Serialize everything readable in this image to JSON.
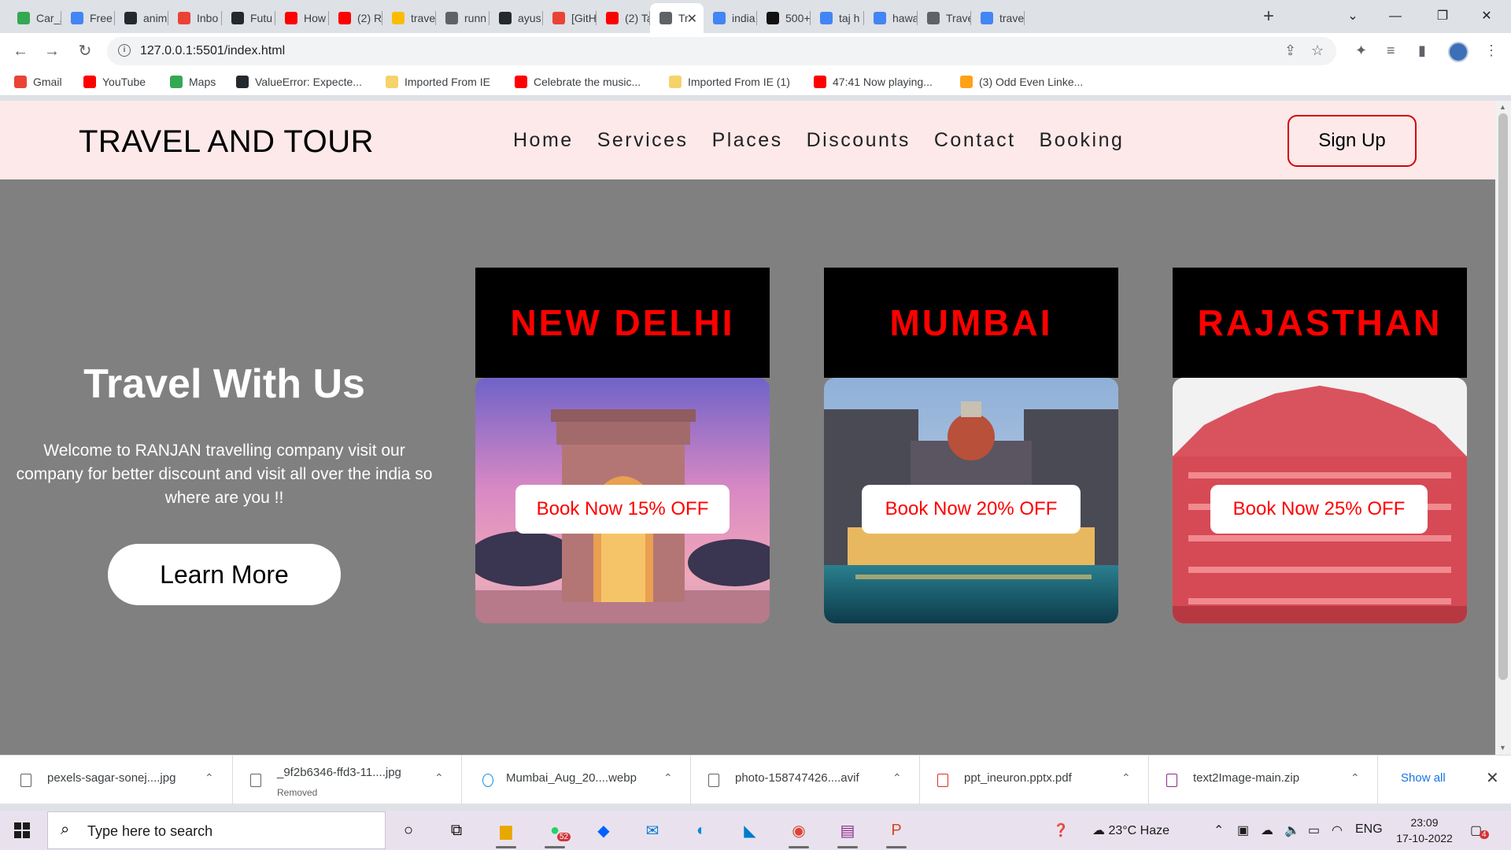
{
  "browser": {
    "tabs": [
      {
        "label": "Car_/",
        "icon": "google-drive-icon",
        "color": "#34a853"
      },
      {
        "label": "Free",
        "icon": "gear-icon",
        "color": "#4285f4"
      },
      {
        "label": "anim",
        "icon": "github-icon",
        "color": "#24292e"
      },
      {
        "label": "Inbo",
        "icon": "gmail-icon",
        "color": "#ea4335"
      },
      {
        "label": "Futu",
        "icon": "github-icon",
        "color": "#24292e"
      },
      {
        "label": "How",
        "icon": "youtube-icon",
        "color": "#ff0000"
      },
      {
        "label": "(2) R",
        "icon": "youtube-icon",
        "color": "#ff0000"
      },
      {
        "label": "trave",
        "icon": "google-drive-icon",
        "color": "#fbbc04"
      },
      {
        "label": "runn",
        "icon": "globe-icon",
        "color": "#5f6368"
      },
      {
        "label": "ayus",
        "icon": "github-icon",
        "color": "#24292e"
      },
      {
        "label": "[GitH",
        "icon": "gmail-icon",
        "color": "#ea4335"
      },
      {
        "label": "(2) Ta",
        "icon": "youtube-icon",
        "color": "#ff0000"
      },
      {
        "label": "Tr",
        "icon": "globe-icon",
        "color": "#5f6368"
      },
      {
        "label": "india",
        "icon": "google-icon",
        "color": "#4285f4"
      },
      {
        "label": "500+",
        "icon": "unsplash-icon",
        "color": "#111111"
      },
      {
        "label": "taj h",
        "icon": "google-icon",
        "color": "#4285f4"
      },
      {
        "label": "hawa",
        "icon": "google-icon",
        "color": "#4285f4"
      },
      {
        "label": "Trave",
        "icon": "globe-icon",
        "color": "#5f6368"
      },
      {
        "label": "trave",
        "icon": "google-icon",
        "color": "#4285f4"
      }
    ],
    "url": "127.0.0.1:5501/index.html",
    "bookmarks": [
      {
        "label": "Gmail",
        "icon": "gmail-icon",
        "color": "#ea4335"
      },
      {
        "label": "YouTube",
        "icon": "youtube-icon",
        "color": "#ff0000"
      },
      {
        "label": "Maps",
        "icon": "maps-pin-icon",
        "color": "#34a853"
      },
      {
        "label": "ValueError: Expecte...",
        "icon": "github-icon",
        "color": "#24292e"
      },
      {
        "label": "Imported From IE",
        "icon": "folder-icon",
        "color": "#f6d26b"
      },
      {
        "label": "Celebrate the music...",
        "icon": "youtube-icon",
        "color": "#ff0000"
      },
      {
        "label": "Imported From IE (1)",
        "icon": "folder-icon",
        "color": "#f6d26b"
      },
      {
        "label": "47:41 Now playing...",
        "icon": "youtube-icon",
        "color": "#ff0000"
      },
      {
        "label": "(3) Odd Even Linke...",
        "icon": "leetcode-icon",
        "color": "#ffa116"
      }
    ]
  },
  "site": {
    "logo": "TRAVEL AND TOUR",
    "nav": [
      "Home",
      "Services",
      "Places",
      "Discounts",
      "Contact",
      "Booking"
    ],
    "signup_label": "Sign Up",
    "hero": {
      "title": "Travel With Us",
      "text": "Welcome to RANJAN travelling company visit our company for better discount and visit all over the india so where are you !!",
      "button": "Learn More"
    },
    "cards": [
      {
        "title": "NEW DELHI",
        "button": "Book Now 15% OFF",
        "image": "india-gate-image"
      },
      {
        "title": "MUMBAI",
        "button": "Book Now 20% OFF",
        "image": "taj-hotel-image"
      },
      {
        "title": "RAJASTHAN",
        "button": "Book Now 25% OFF",
        "image": "hawa-mahal-image"
      }
    ],
    "colors": {
      "header_bg": "#fde9ea",
      "page_bg": "#808080",
      "accent": "#ff0000"
    }
  },
  "downloads": {
    "items": [
      {
        "name": "pexels-sagar-sonej....jpg",
        "sub": ""
      },
      {
        "name": "_9f2b6346-ffd3-11....jpg",
        "sub": "Removed"
      },
      {
        "name": "Mumbai_Aug_20....webp",
        "sub": ""
      },
      {
        "name": "photo-158747426....avif",
        "sub": ""
      },
      {
        "name": "ppt_ineuron.pptx.pdf",
        "sub": ""
      },
      {
        "name": "text2Image-main.zip",
        "sub": ""
      }
    ],
    "show_all": "Show all"
  },
  "taskbar": {
    "search_placeholder": "Type here to search",
    "whatsapp_badge": "52",
    "weather": "23°C  Haze",
    "language": "ENG",
    "time": "23:09",
    "date": "17-10-2022",
    "notification_count": "4"
  }
}
